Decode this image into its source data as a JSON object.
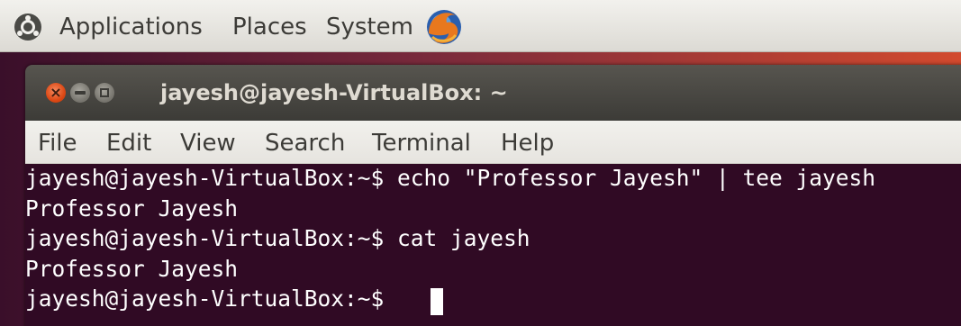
{
  "panel": {
    "menus": [
      "Applications",
      "Places",
      "System"
    ],
    "icons": [
      "ubuntu-logo-icon",
      "firefox-icon"
    ]
  },
  "window": {
    "title": "jayesh@jayesh-VirtualBox: ~",
    "buttons": [
      "close",
      "minimize",
      "maximize"
    ],
    "close_glyph": "×"
  },
  "menubar": {
    "items": [
      "File",
      "Edit",
      "View",
      "Search",
      "Terminal",
      "Help"
    ]
  },
  "terminal": {
    "lines": [
      "jayesh@jayesh-VirtualBox:~$ echo \"Professor Jayesh\" | tee jayesh",
      "Professor Jayesh",
      "jayesh@jayesh-VirtualBox:~$ cat jayesh",
      "Professor Jayesh",
      "jayesh@jayesh-VirtualBox:~$ "
    ],
    "background_color": "#300a24",
    "text_color": "#ffffff"
  },
  "colors": {
    "close_button": "#dd4814",
    "titlebar": "#3c3b37",
    "panel": "#f2f1ed"
  }
}
